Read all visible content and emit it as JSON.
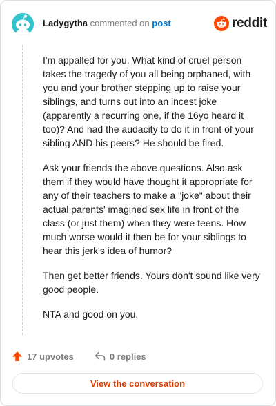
{
  "comment": {
    "username": "Ladygytha",
    "action_text": "commented on",
    "post_link": "post"
  },
  "brand": {
    "wordmark": "reddit",
    "icon": "reddit-snoo-icon",
    "color": "#ff4500"
  },
  "body_paragraphs": [
    "I'm appalled for you. What kind of cruel person takes the tragedy of you all being orphaned, with you and your brother stepping up to raise your siblings, and turns out into an incest joke (apparently a recurring one, if the 16yo heard it too)? And had the audacity to do it in front of your sibling AND his peers? He should be fired.",
    "Ask your friends the above questions. Also ask them if they would have thought it appropriate for any of their teachers to make a \"joke\" about their actual parents' imagined sex life in front of the class (or just them) when they were teens. How much worse would it then be for your siblings to hear this jerk's idea of humor?",
    "Then get better friends. Yours don't sound like very good people.",
    "NTA and good on you."
  ],
  "actions": {
    "upvotes": "17 upvotes",
    "replies": "0 replies",
    "upvote_icon": "upvote-arrow-icon",
    "reply_icon": "reply-arrow-icon"
  },
  "view_button": "View the conversation",
  "colors": {
    "accent": "#d93a00",
    "upvote": "#ff4500",
    "link": "#0079d3",
    "avatar_bg": "#32c3cc"
  }
}
